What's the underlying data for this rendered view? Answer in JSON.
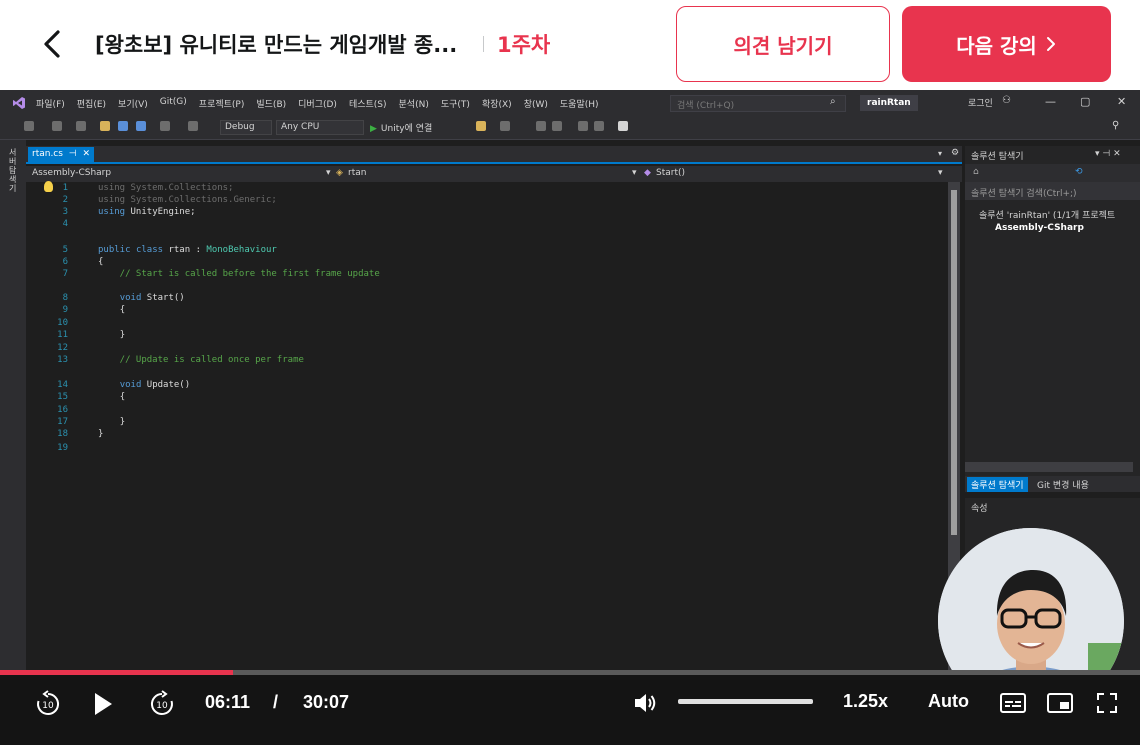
{
  "header": {
    "course_title": "[왕초보] 유니티로 만드는 게임개발 종...",
    "week": "1주차",
    "feedback_label": "의견 남기기",
    "next_label": "다음 강의"
  },
  "vs": {
    "menu": [
      "파일(F)",
      "편집(E)",
      "보기(V)",
      "Git(G)",
      "프로젝트(P)",
      "빌드(B)",
      "디버그(D)",
      "테스트(S)",
      "분석(N)",
      "도구(T)",
      "확장(X)",
      "창(W)",
      "도움말(H)"
    ],
    "search_placeholder": "검색 (Ctrl+Q)",
    "project_name": "rainRtan",
    "login": "로그인",
    "config": "Debug",
    "platform": "Any CPU",
    "run_label": "Unity에 연결",
    "side_label": "서버 탐색기",
    "tab_name": "rtan.cs",
    "nav_project": "Assembly-CSharp",
    "nav_class": "rtan",
    "nav_member": "Start()",
    "code": [
      {
        "n": "1",
        "t": "using System.Collections;"
      },
      {
        "n": "2",
        "t": "using System.Collections.Generic;"
      },
      {
        "n": "3",
        "t": "using UnityEngine;"
      },
      {
        "n": "4",
        "t": ""
      },
      {
        "n": "5",
        "t": "public class rtan : MonoBehaviour"
      },
      {
        "n": "6",
        "t": "{"
      },
      {
        "n": "7",
        "t": "    // Start is called before the first frame update"
      },
      {
        "n": "8",
        "t": "    void Start()"
      },
      {
        "n": "9",
        "t": "    {"
      },
      {
        "n": "10",
        "t": ""
      },
      {
        "n": "11",
        "t": "    }"
      },
      {
        "n": "12",
        "t": ""
      },
      {
        "n": "13",
        "t": "    // Update is called once per frame"
      },
      {
        "n": "14",
        "t": "    void Update()"
      },
      {
        "n": "15",
        "t": "    {"
      },
      {
        "n": "16",
        "t": ""
      },
      {
        "n": "17",
        "t": "    }"
      },
      {
        "n": "18",
        "t": "}"
      },
      {
        "n": "19",
        "t": ""
      }
    ],
    "solution": {
      "title": "솔루션 탐색기",
      "search": "솔루션 탐색기 검색(Ctrl+;)",
      "root": "솔루션 'rainRtan' (1/1개 프로젝트",
      "project": "Assembly-CSharp",
      "tab_active": "솔루션 탐색기",
      "tab_git": "Git 변경 내용",
      "props_title": "속성"
    }
  },
  "player": {
    "current_time": "06:11",
    "time_sep": "/",
    "duration": "30:07",
    "progress": 0.204,
    "speed": "1.25x",
    "quality": "Auto",
    "skip_back_seconds": "10",
    "skip_fwd_seconds": "10"
  },
  "colors": {
    "accent": "#e8344e",
    "vs_blue": "#007acc"
  }
}
